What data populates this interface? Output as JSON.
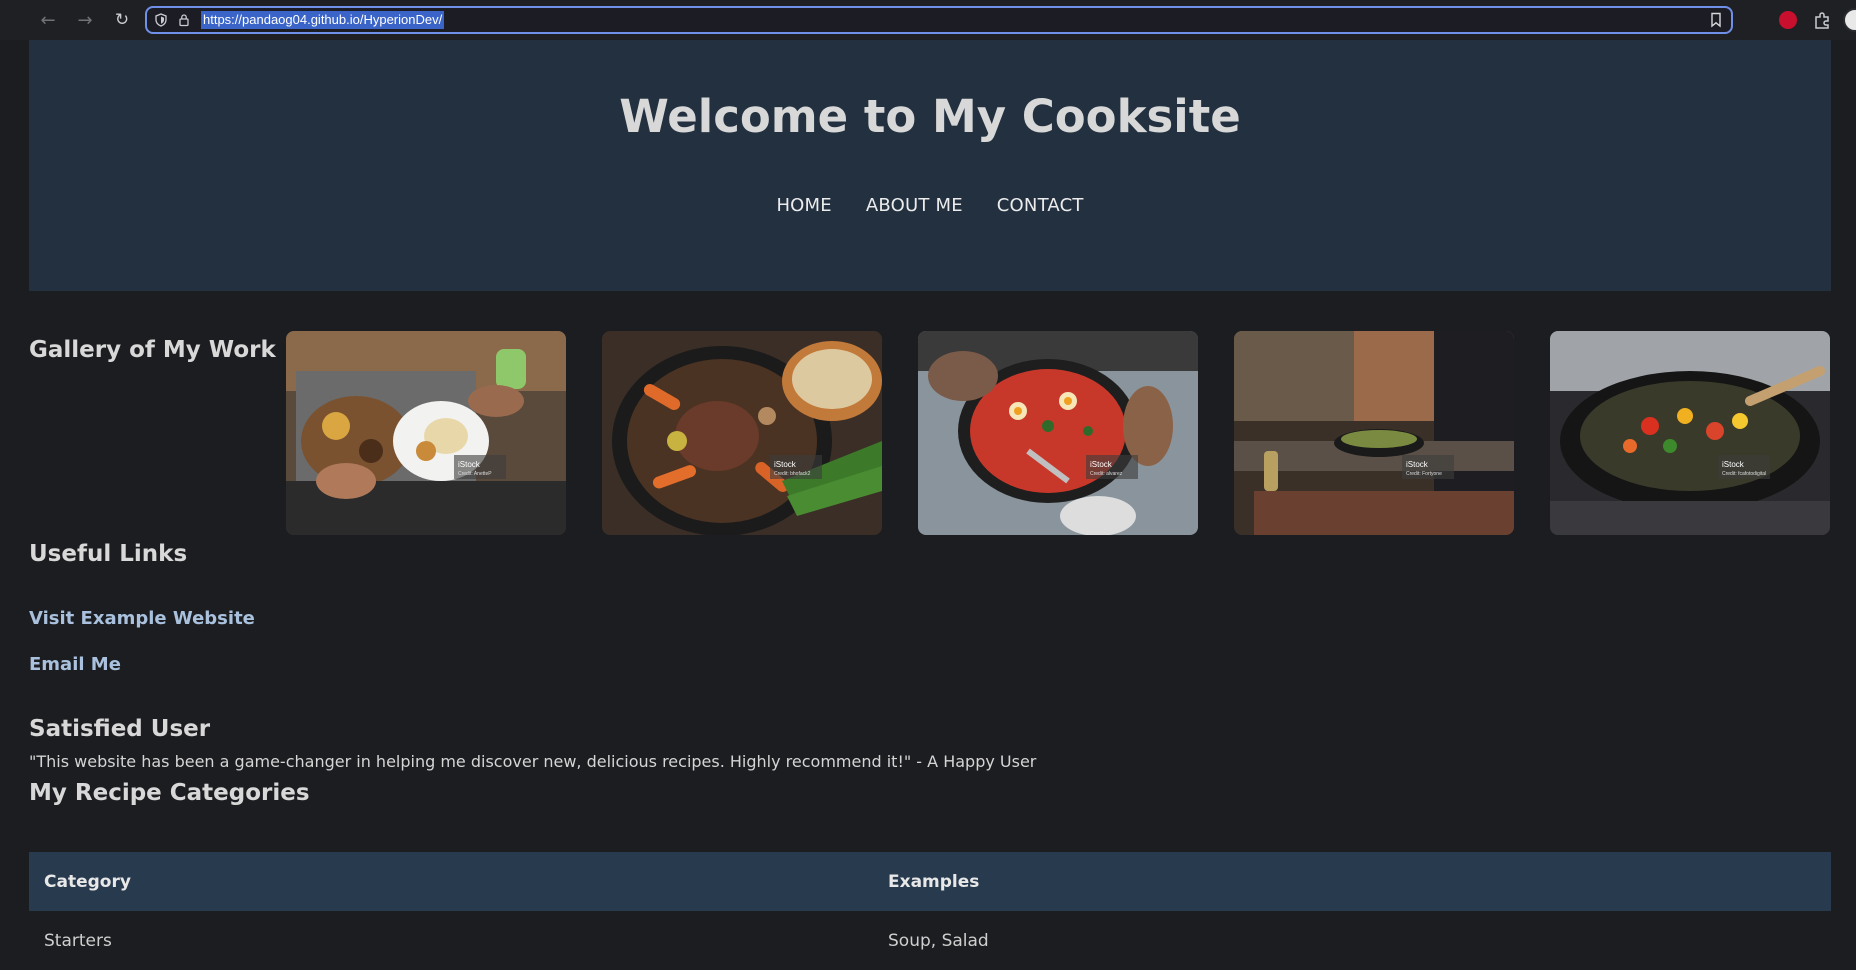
{
  "browser": {
    "url": "https://pandaog04.github.io/HyperionDev/",
    "icons": [
      "back-icon",
      "forward-icon",
      "reload-icon",
      "shield-icon",
      "lock-icon",
      "bookmark-icon",
      "extension-puzzle-icon",
      "avatar"
    ]
  },
  "header": {
    "title": "Welcome to My Cooksite",
    "nav": [
      "HOME",
      "ABOUT ME",
      "CONTACT"
    ]
  },
  "gallery": {
    "heading": "Gallery of My Work",
    "images": [
      {
        "watermark": "iStock",
        "credit": "Credit: AnetteP"
      },
      {
        "watermark": "iStock",
        "credit": "Credit: bhofack2"
      },
      {
        "watermark": "iStock",
        "credit": "Credit: alvarez"
      },
      {
        "watermark": "iStock",
        "credit": "Credit: Fortyone"
      },
      {
        "watermark": "iStock",
        "credit": "Credit: fcafotodigital"
      }
    ]
  },
  "links": {
    "heading": "Useful Links",
    "items": [
      "Visit Example Website",
      "Email Me"
    ]
  },
  "testimonial": {
    "heading": "Satisfied User",
    "quote": "\"This website has been a game-changer in helping me discover new, delicious recipes. Highly recommend it!\" - A Happy User"
  },
  "categories": {
    "heading": "My Recipe Categories",
    "columns": [
      "Category",
      "Examples"
    ],
    "rows": [
      [
        "Starters",
        "Soup, Salad"
      ]
    ]
  },
  "colors": {
    "page_bg": "#1c1d20",
    "header_bg": "#223040",
    "table_head_bg": "#283a4e",
    "link": "#a9c1dd"
  }
}
